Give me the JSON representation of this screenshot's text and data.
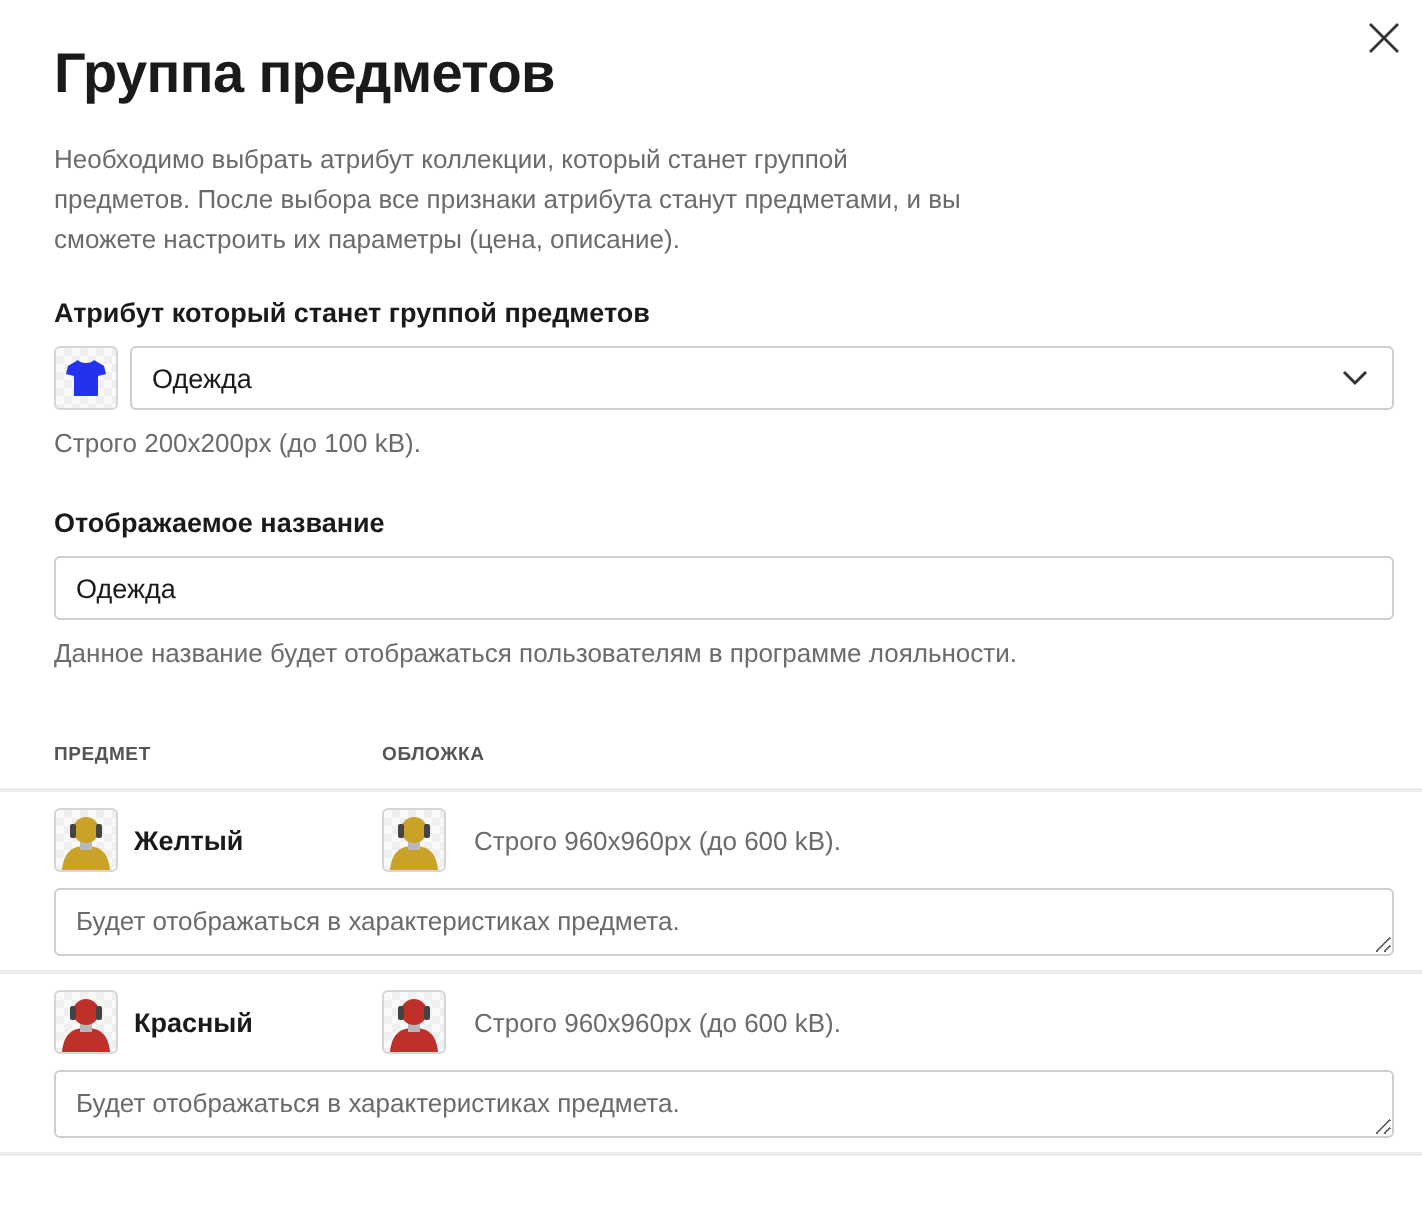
{
  "title": "Группа предметов",
  "description": "Необходимо выбрать атрибут коллекции, который станет группой предметов. После выбора все признаки атрибута станут предметами, и вы сможете настроить их параметры (цена, описание).",
  "attribute": {
    "label": "Атрибут который станет группой предметов",
    "value": "Одежда",
    "hint": "Строго 200x200px (до 100 kB)."
  },
  "display_name": {
    "label": "Отображаемое название",
    "value": "Одежда",
    "hint": "Данное название будет отображаться пользователям в программе лояльности."
  },
  "table": {
    "columns": [
      "ПРЕДМЕТ",
      "ОБЛОЖКА"
    ],
    "rows": [
      {
        "name": "Желтый",
        "color": "#c9a227",
        "cover_hint": "Строго 960x960px (до 600 kB).",
        "placeholder": "Будет отображаться в характеристиках предмета."
      },
      {
        "name": "Красный",
        "color": "#c0302a",
        "cover_hint": "Строго 960x960px (до 600 kB).",
        "placeholder": "Будет отображаться в характеристиках предмета."
      }
    ]
  }
}
